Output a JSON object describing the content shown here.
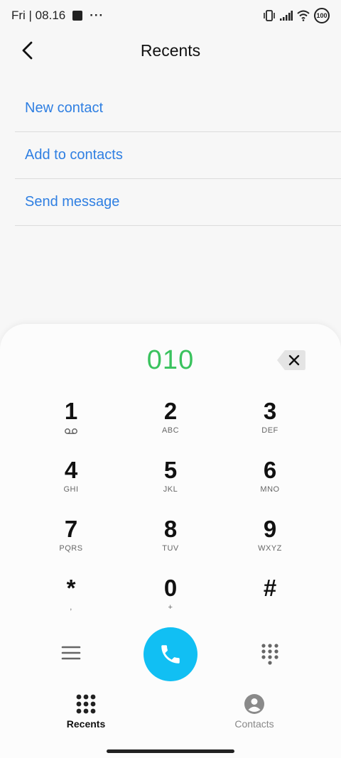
{
  "status_bar": {
    "time": "Fri | 08.16",
    "more": "···",
    "battery": "100"
  },
  "header": {
    "title": "Recents",
    "back_icon": "chevron-left-icon"
  },
  "menu": {
    "items": [
      {
        "label": "New contact"
      },
      {
        "label": "Add to contacts"
      },
      {
        "label": "Send message"
      }
    ]
  },
  "dialer": {
    "number": "010",
    "keys": [
      [
        {
          "digit": "1",
          "letters": ""
        },
        {
          "digit": "2",
          "letters": "ABC"
        },
        {
          "digit": "3",
          "letters": "DEF"
        }
      ],
      [
        {
          "digit": "4",
          "letters": "GHI"
        },
        {
          "digit": "5",
          "letters": "JKL"
        },
        {
          "digit": "6",
          "letters": "MNO"
        }
      ],
      [
        {
          "digit": "7",
          "letters": "PQRS"
        },
        {
          "digit": "8",
          "letters": "TUV"
        },
        {
          "digit": "9",
          "letters": "WXYZ"
        }
      ],
      [
        {
          "digit": "*",
          "letters": ","
        },
        {
          "digit": "0",
          "letters": "+"
        },
        {
          "digit": "#",
          "letters": ""
        }
      ]
    ]
  },
  "bottom_nav": {
    "recents_label": "Recents",
    "contacts_label": "Contacts"
  },
  "colors": {
    "accent_link": "#2f7fe2",
    "number_green": "#39c25d",
    "call_button": "#11bff3"
  }
}
